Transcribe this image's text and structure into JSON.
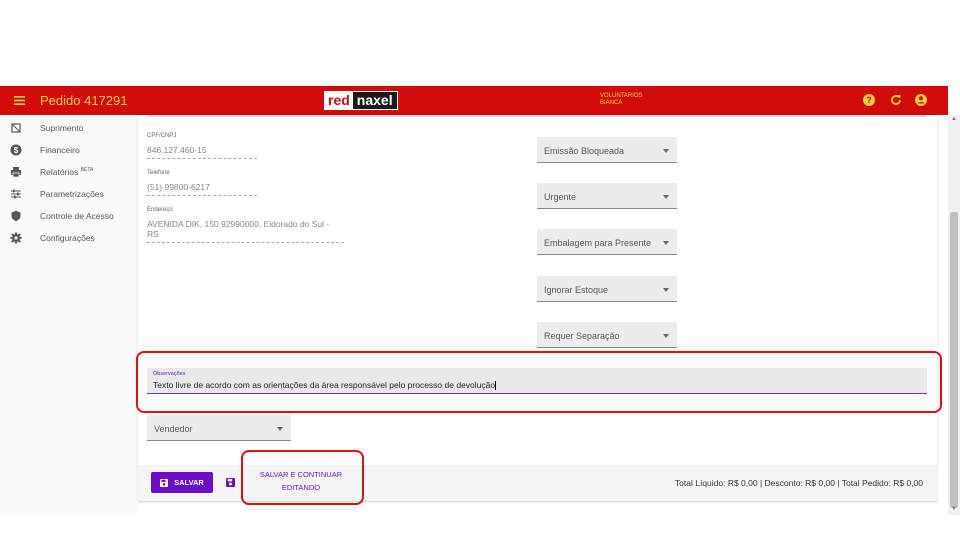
{
  "header": {
    "title": "Pedido 417291",
    "logo_left": "red",
    "logo_right": "naxel",
    "user_line1": "VOLUNTARIOS",
    "user_line2": "BIANCA",
    "colors": {
      "bar": "#d10a0a",
      "title": "#ffd23a"
    }
  },
  "sidebar": {
    "items": [
      {
        "label": "Suprimento",
        "icon": "supply-icon"
      },
      {
        "label": "Financeiro",
        "icon": "dollar-icon"
      },
      {
        "label": "Relatórios",
        "badge": "BETA",
        "icon": "printer-icon"
      },
      {
        "label": "Parametrizações",
        "icon": "sliders-icon"
      },
      {
        "label": "Controle de Acesso",
        "icon": "shield-icon"
      },
      {
        "label": "Configurações",
        "icon": "gear-icon"
      }
    ]
  },
  "customer": {
    "cpf_label": "CPF/CNPJ",
    "cpf_value": "846.127.460-15",
    "phone_label": "Telefone",
    "phone_value": "(51) 99800-6217",
    "address_label": "Endereço",
    "address_value_line1": "AVENIDA DIK, 150 92990000, Eldorado do Sul -",
    "address_value_line2": "RS"
  },
  "options": {
    "selects": [
      "Emissão Bloqueada",
      "Urgente",
      "Embalagem para Presente",
      "Ignorar Estoque",
      "Requer Separação"
    ]
  },
  "observations": {
    "label": "Observações",
    "value": "Texto livre de acordo com as orientações da área responsável pelo processo de devolução"
  },
  "vendor": {
    "label": "Vendedor"
  },
  "footer": {
    "save_label": "SALVAR",
    "continue_line1": "SALVAR E CONTINUAR",
    "continue_line2": "EDITANDO",
    "totals": "Total Líquido: R$ 0,00 | Desconto: R$ 0,00 | Total Pedido: R$ 0,00",
    "accent": "#6a0fc7"
  }
}
